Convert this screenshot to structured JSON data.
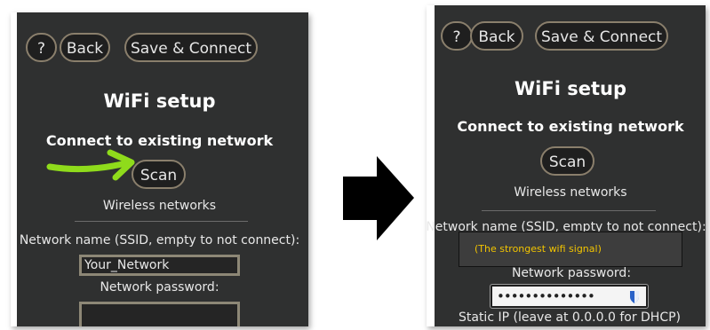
{
  "left": {
    "buttons": {
      "help": "?",
      "back": "Back",
      "save": "Save & Connect",
      "scan": "Scan"
    },
    "title": "WiFi setup",
    "subtitle": "Connect to existing network",
    "wireless": "Wireless networks",
    "ssid_label": "Network name (SSID, empty to not connect):",
    "ssid_value": "Your_Network",
    "password_label": "Network password:",
    "password_value": ""
  },
  "right": {
    "buttons": {
      "help": "?",
      "back": "Back",
      "save": "Save & Connect",
      "scan": "Scan"
    },
    "title": "WiFi setup",
    "subtitle": "Connect to existing network",
    "wireless": "Wireless networks",
    "ssid_label": "Network name (SSID, empty to not connect):",
    "ssid_hint": "(The strongest wifi signal)",
    "password_label": "Network password:",
    "password_value": "••••••••••••••",
    "static_ip_label": "Static IP (leave at 0.0.0.0 for DHCP)"
  },
  "colors": {
    "panel_bg": "#2f3030",
    "button_border": "#8a7f6c",
    "hint_text": "#f2c400",
    "annotation_green": "#8fdb1b"
  },
  "icons": [
    "green-arrow-icon",
    "black-right-arrow-icon",
    "key-icon"
  ]
}
